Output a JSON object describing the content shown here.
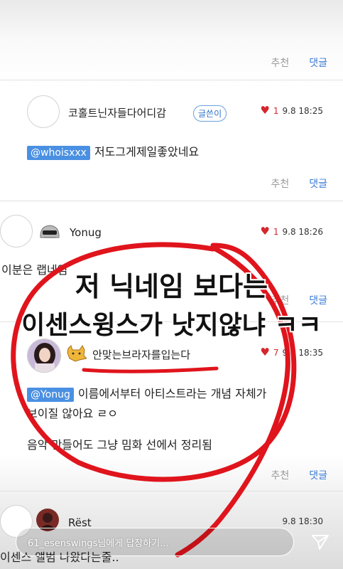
{
  "top": {
    "rec_label": "추천",
    "reply_label": "댓글"
  },
  "comments": [
    {
      "nickname": "코홀트닌자들다어디감",
      "badge": "글쓴이",
      "likes": "1",
      "time": "9.8 18:25",
      "mention": "@whoisxxx",
      "text": "저도그게제일좋았네요",
      "rec_label": "추천",
      "reply_label": "댓글"
    },
    {
      "nickname": "Yonug",
      "likes": "1",
      "time": "9.8 18:26",
      "text": "이분은 랩네임",
      "rec_label": "추천",
      "reply_label": "댓글"
    },
    {
      "nickname": "안맞는브라자를입는다",
      "likes": "7",
      "time": "9.8 18:35",
      "mention": "@Yonug",
      "text_line1": "이름에서부터 아티스트라는 개념 자체가",
      "text_line2": "보이질 않아요 ㄹㅇ",
      "text_line3": "음악 만들어도 그냥 밈화 선에서 정리됨",
      "rec_label": "추천",
      "reply_label": "댓글"
    },
    {
      "nickname": "Rëst",
      "time": "9.8 18:30",
      "text": "이센스 앨범 나왔다는줄.."
    }
  ],
  "overlay": {
    "line1": "저 닉네임 보다는",
    "line2": "이센스윙스가 낫지않냐 ㅋㅋ"
  },
  "reply_bar": {
    "placeholder": "61_esenswings님에게 답장하기..."
  },
  "icons": {
    "heart": "heart-icon",
    "send": "send-icon",
    "helmet": "helmet-level-icon",
    "dog": "dog-level-icon"
  },
  "colors": {
    "accent": "#3a7bd5",
    "mention_bg": "#4a90e2",
    "heart": "#d4262c",
    "annotation": "#e0141c"
  }
}
